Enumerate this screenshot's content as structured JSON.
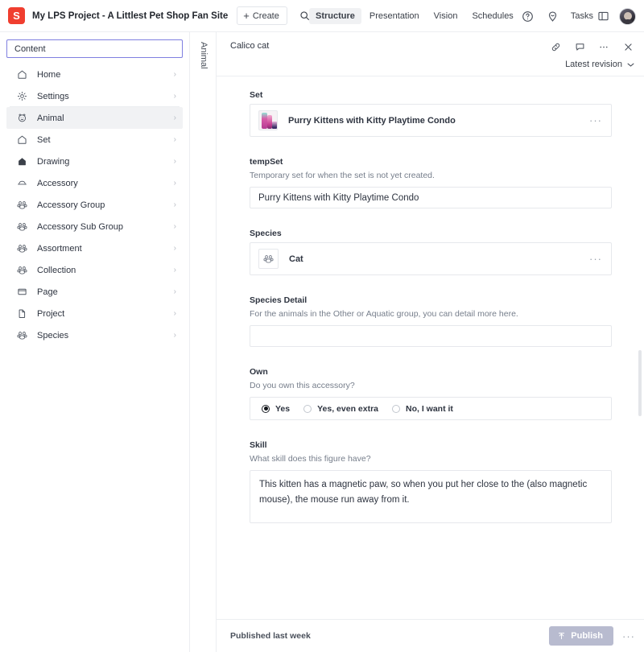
{
  "topbar": {
    "logo_letter": "S",
    "logo_color": "#f03e2f",
    "project_title": "My LPS Project - A Littlest Pet Shop Fan Site",
    "create_label": "Create",
    "create_plus": "+",
    "search_icon": "search-icon",
    "nav_tabs": [
      {
        "label": "Structure",
        "active": true
      },
      {
        "label": "Presentation",
        "active": false
      },
      {
        "label": "Vision",
        "active": false
      },
      {
        "label": "Schedules",
        "active": false
      }
    ],
    "help_icon": "help-circle-icon",
    "alien_icon": "alien-icon",
    "tasks_label": "Tasks",
    "tasks_icon": "panel-icon",
    "avatar": "user-avatar"
  },
  "sidebar": {
    "header_label": "Content",
    "items": [
      {
        "label": "Home",
        "icon": "home-icon",
        "selected": false
      },
      {
        "label": "Settings",
        "icon": "gear-icon",
        "selected": false
      },
      {
        "label": "Animal",
        "icon": "animal-face-icon",
        "selected": true
      },
      {
        "label": "Set",
        "icon": "home-icon",
        "selected": false
      },
      {
        "label": "Drawing",
        "icon": "home-filled-icon",
        "selected": false
      },
      {
        "label": "Accessory",
        "icon": "hat-icon",
        "selected": false
      },
      {
        "label": "Accessory Group",
        "icon": "paw-icon",
        "selected": false
      },
      {
        "label": "Accessory Sub Group",
        "icon": "paw-icon",
        "selected": false
      },
      {
        "label": "Assortment",
        "icon": "paw-icon",
        "selected": false
      },
      {
        "label": "Collection",
        "icon": "paw-icon",
        "selected": false
      },
      {
        "label": "Page",
        "icon": "window-icon",
        "selected": false
      },
      {
        "label": "Project",
        "icon": "document-icon",
        "selected": false
      },
      {
        "label": "Species",
        "icon": "paw-icon",
        "selected": false
      }
    ],
    "chevron": "›"
  },
  "document": {
    "vertical_tab_label": "Animal",
    "title": "Calico cat",
    "header_icons": [
      "link-icon",
      "comment-icon",
      "more-options-icon",
      "close-icon"
    ],
    "revision_label": "Latest revision",
    "revision_chevron": "chevron-down-icon",
    "fields": [
      {
        "type": "reference",
        "label": "Set",
        "desc": "",
        "value": "Purry Kittens with Kitty Playtime Condo",
        "thumb": "set-thumbnail",
        "more": "···"
      },
      {
        "type": "text",
        "label": "tempSet",
        "desc": "Temporary set for when the set is not yet created.",
        "value": "Purry Kittens with Kitty Playtime Condo",
        "placeholder": ""
      },
      {
        "type": "reference",
        "label": "Species",
        "desc": "",
        "value": "Cat",
        "thumb": "paw-icon",
        "more": "···"
      },
      {
        "type": "text",
        "label": "Species Detail",
        "desc": "For the animals in the Other or Aquatic group, you can detail more here.",
        "value": "",
        "placeholder": ""
      },
      {
        "type": "radio",
        "label": "Own",
        "desc": "Do you own this accessory?",
        "options": [
          {
            "label": "Yes",
            "checked": true
          },
          {
            "label": "Yes, even extra",
            "checked": false
          },
          {
            "label": "No, I want it",
            "checked": false
          }
        ]
      },
      {
        "type": "textarea",
        "label": "Skill",
        "desc": "What skill does this figure have?",
        "value": "This kitten has a magnetic paw, so when you put her close to the (also magnetic mouse), the mouse run away from it."
      }
    ],
    "footer": {
      "status": "Published last week",
      "publish_label": "Publish",
      "publish_icon": "upload-icon",
      "more": "···"
    }
  }
}
